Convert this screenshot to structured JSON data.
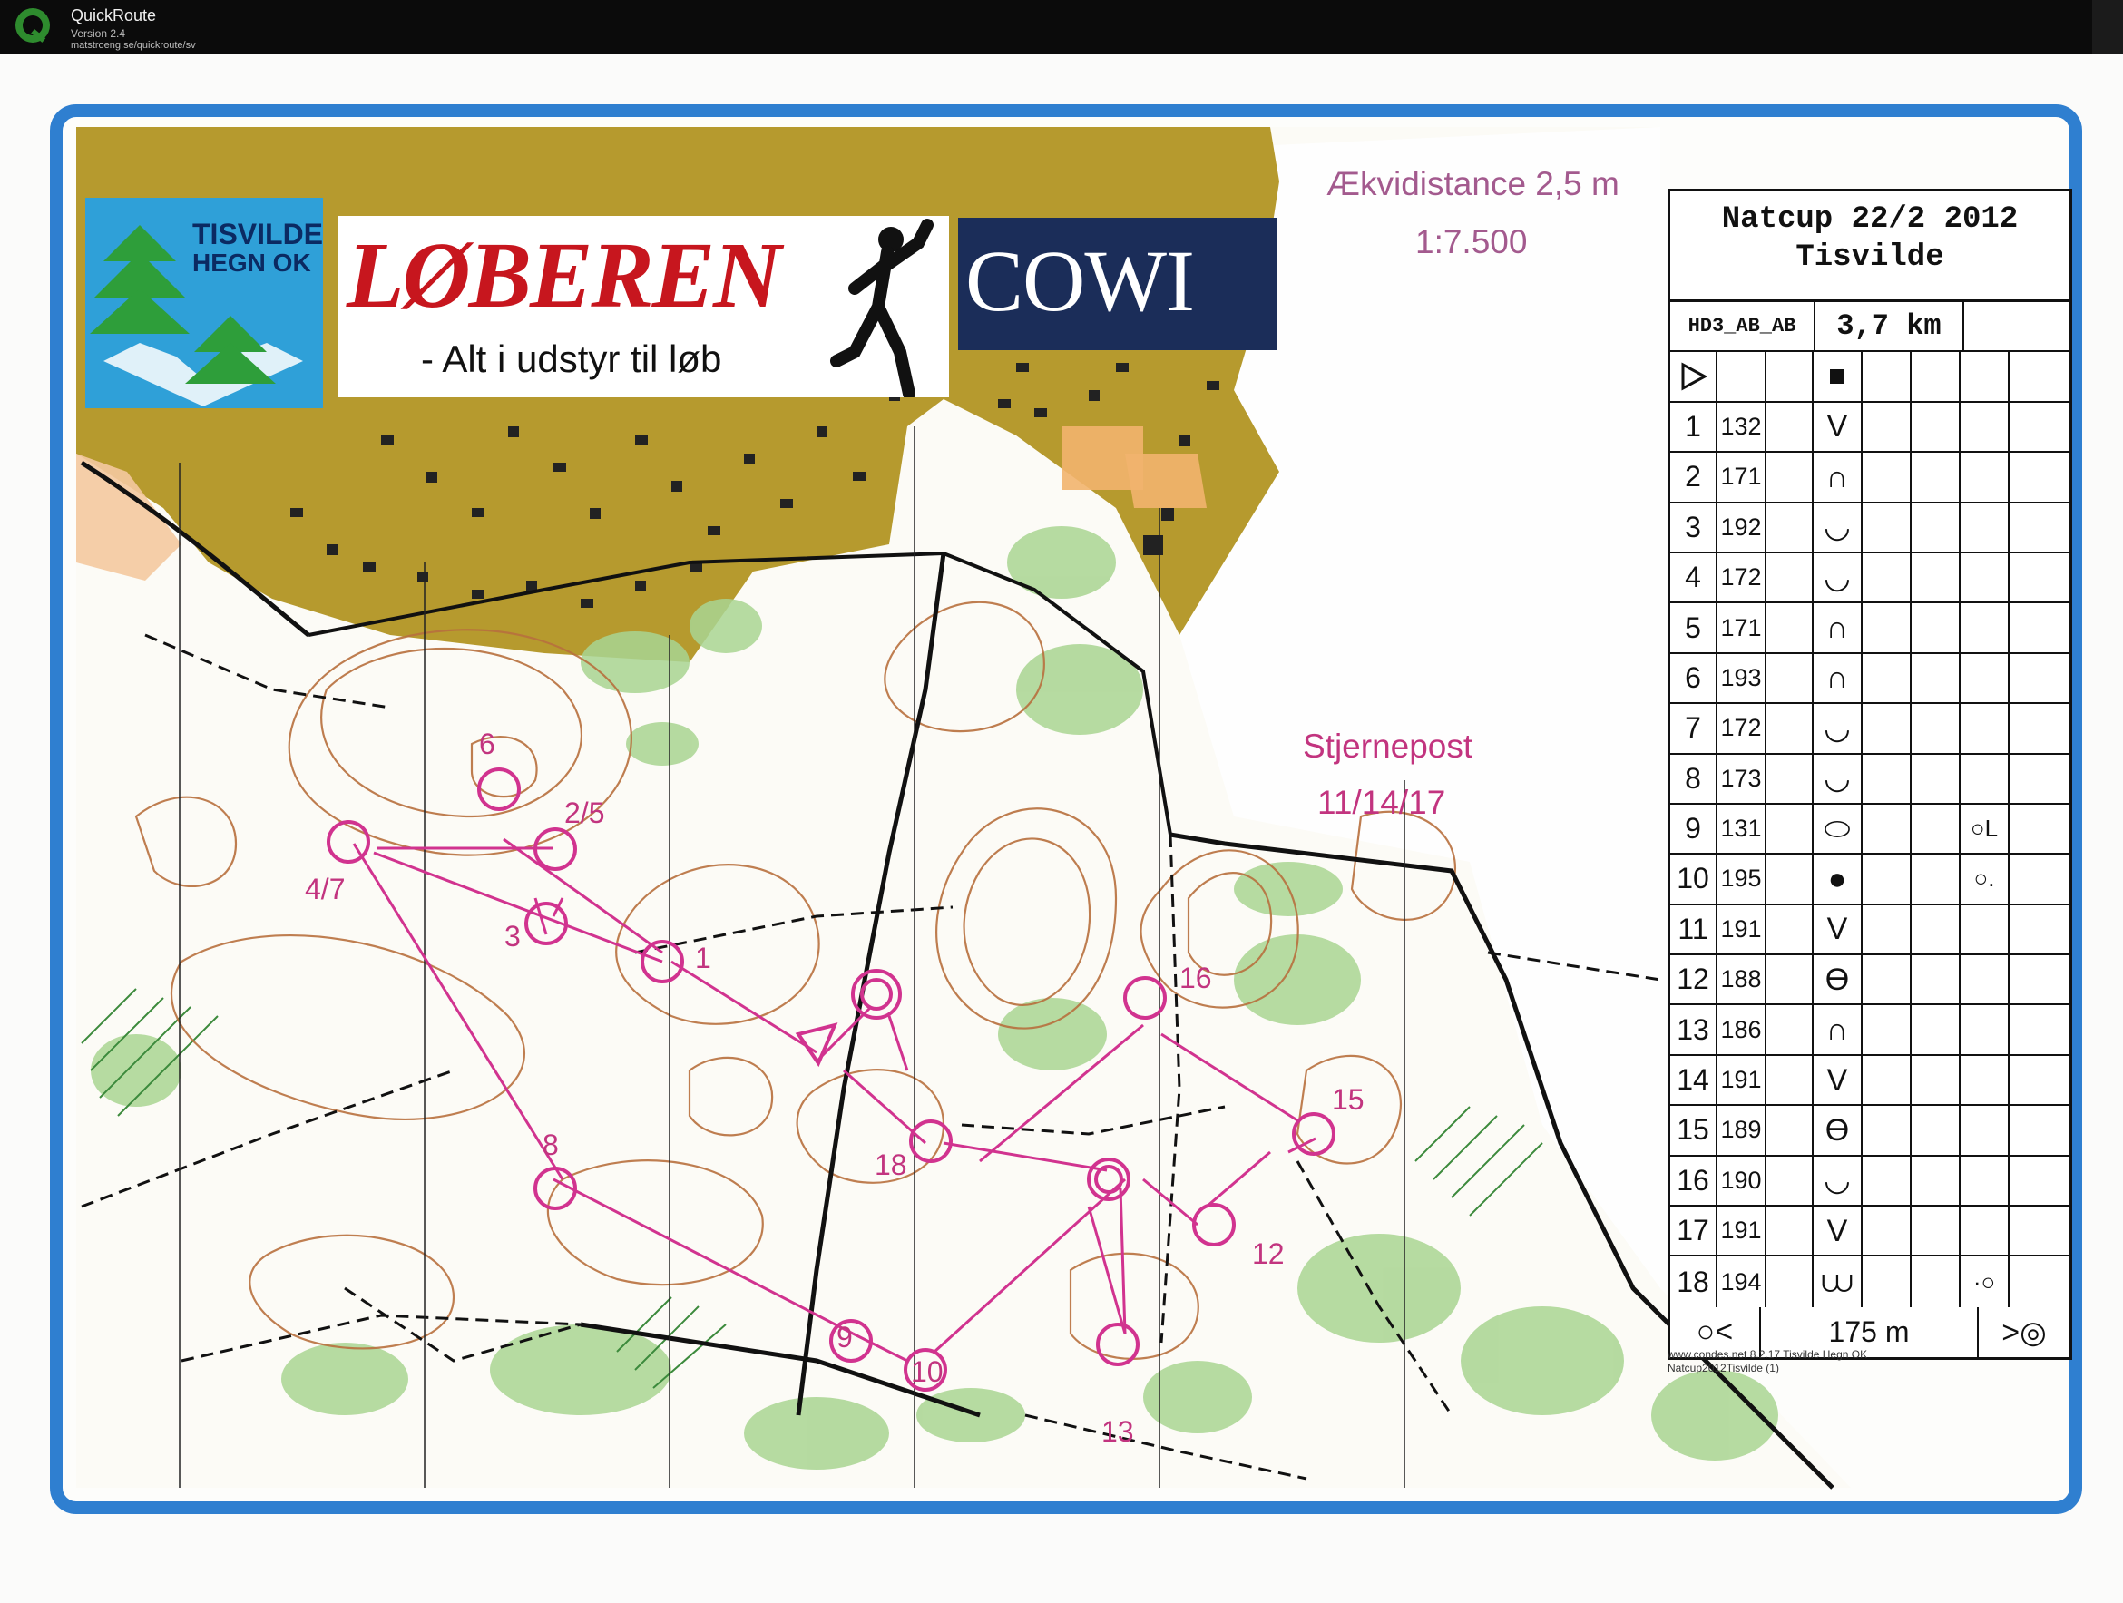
{
  "app": {
    "name": "QuickRoute",
    "version": "Version 2.4",
    "url": "matstroeng.se/quickroute/sv"
  },
  "map": {
    "contour_interval": "Ækvidistance 2,5 m",
    "scale": "1:7.500",
    "star_post_label": "Stjernepost",
    "star_post_controls": "11/14/17",
    "credit_line1": "www.condes.net 8.2.17 Tisvilde Hegn OK",
    "credit_line2": "Natcup2012Tisvilde (1)",
    "colors": {
      "border_blue": "#2f7fd0",
      "course_magenta": "#d1338f",
      "settlement_olive": "#b39226",
      "vegetation_green": "#a7d38f",
      "contour_brown": "#b86b3c"
    }
  },
  "sponsors": {
    "club_line1": "TISVILDE",
    "club_line2": "HEGN OK",
    "shop_name": "LØBEREN",
    "shop_tagline": "- Alt i udstyr til løb",
    "cowi": "COWI"
  },
  "course_labels": {
    "c6": "6",
    "c2_5": "2/5",
    "c4_7": "4/7",
    "c3": "3",
    "c1": "1",
    "c16": "16",
    "c15": "15",
    "c18": "18",
    "c8": "8",
    "c12": "12",
    "c9": "9",
    "c10": "10",
    "c13": "13"
  },
  "description": {
    "event": "Natcup 22/2 2012",
    "place": "Tisvilde",
    "course": "HD3_AB_AB",
    "length": "3,7 km",
    "start_symbol": "start-triangle",
    "start_feature_symbol": "filled-square",
    "controls": [
      {
        "num": "1",
        "code": "132",
        "feature": "V"
      },
      {
        "num": "2",
        "code": "171",
        "feature": "∩"
      },
      {
        "num": "3",
        "code": "192",
        "feature": "◡"
      },
      {
        "num": "4",
        "code": "172",
        "feature": "◡"
      },
      {
        "num": "5",
        "code": "171",
        "feature": "∩"
      },
      {
        "num": "6",
        "code": "193",
        "feature": "∩"
      },
      {
        "num": "7",
        "code": "172",
        "feature": "◡"
      },
      {
        "num": "8",
        "code": "173",
        "feature": "◡"
      },
      {
        "num": "9",
        "code": "131",
        "feature": "⬭",
        "extra": "○L"
      },
      {
        "num": "10",
        "code": "195",
        "feature": "●",
        "extra": "○."
      },
      {
        "num": "11",
        "code": "191",
        "feature": "V"
      },
      {
        "num": "12",
        "code": "188",
        "feature": "ϴ"
      },
      {
        "num": "13",
        "code": "186",
        "feature": "∩"
      },
      {
        "num": "14",
        "code": "191",
        "feature": "V"
      },
      {
        "num": "15",
        "code": "189",
        "feature": "ϴ"
      },
      {
        "num": "16",
        "code": "190",
        "feature": "◡"
      },
      {
        "num": "17",
        "code": "191",
        "feature": "V"
      },
      {
        "num": "18",
        "code": "194",
        "feature": "⩊",
        "extra": "·○"
      }
    ],
    "finish_left": "○<",
    "finish_distance": "175 m",
    "finish_right": ">◎"
  }
}
